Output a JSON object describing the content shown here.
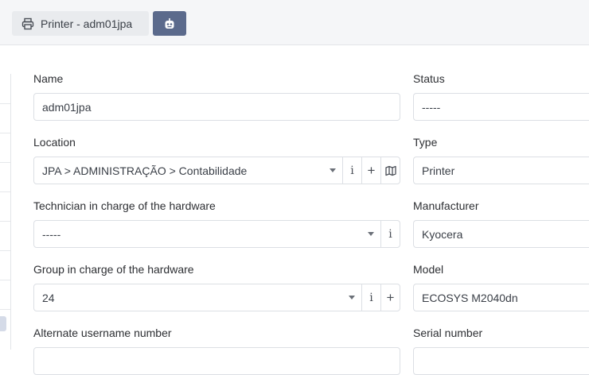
{
  "header": {
    "tab_label": "Printer - adm01jpa",
    "tab_icon": "printer-icon",
    "assistant_icon": "robot-icon"
  },
  "form": {
    "name": {
      "label": "Name",
      "value": "adm01jpa"
    },
    "status": {
      "label": "Status",
      "value": "-----"
    },
    "location": {
      "label": "Location",
      "value": "JPA > ADMINISTRAÇÃO > Contabilidade"
    },
    "type": {
      "label": "Type",
      "value": "Printer"
    },
    "technician": {
      "label": "Technician in charge of the hardware",
      "value": "-----"
    },
    "manufacturer": {
      "label": "Manufacturer",
      "value": "Kyocera"
    },
    "group": {
      "label": "Group in charge of the hardware",
      "value": "24"
    },
    "model": {
      "label": "Model",
      "value": "ECOSYS M2040dn"
    },
    "alternate_username_number": {
      "label": "Alternate username number"
    },
    "serial_number": {
      "label": "Serial number"
    }
  },
  "icons": {
    "info": "i",
    "add": "+",
    "map": "map-icon"
  }
}
